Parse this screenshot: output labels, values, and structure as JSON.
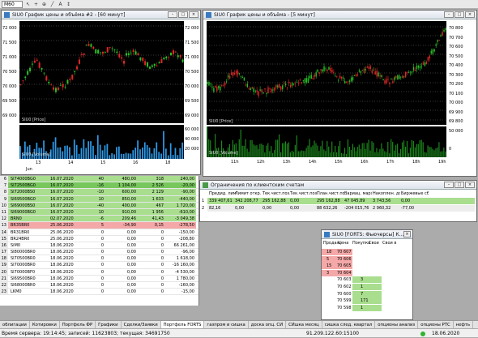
{
  "toolbar": {
    "combo": "M60",
    "icons": [
      "pointer-icon",
      "crosshair-icon",
      "zoom-icon",
      "line-icon",
      "text-icon",
      "arrows-icon"
    ]
  },
  "win1": {
    "title": "SIU0 График цены и объёма #2 - [60 минут]",
    "y_ticks": [
      "72 000",
      "71 500",
      "71 000",
      "70 500",
      "70 000",
      "69 500",
      "69 000"
    ],
    "price_label": "SIU0 [Price]",
    "volume_label": "SIU0 [Volume]",
    "vol_ticks": [
      "60 000",
      "40 000",
      "20 000"
    ],
    "x_ticks": [
      "13",
      "14",
      "15",
      "16",
      "18"
    ],
    "x_sub": "Jun"
  },
  "win2": {
    "title": "SIU0 График цены и объёма - [5 минут]",
    "y_ticks": [
      "70 800",
      "70 700",
      "70 600",
      "70 500",
      "70 400",
      "70 300",
      "70 200",
      "70 100",
      "70 000",
      "69 900",
      "69 800"
    ],
    "price_label": "SIU0 [Price]",
    "volume_label": "SIU0 [Volume]",
    "vol_ticks": [
      "50 000",
      "0"
    ],
    "x_ticks": [
      "11h",
      "12h",
      "13h",
      "14h",
      "15h",
      "16h",
      "17h",
      "18h",
      "19h"
    ]
  },
  "limits": {
    "title": "Ограничения по клиентским счетам",
    "headers": [
      "Предид. лимит",
      "Лимит откр. п",
      "Тек.чист.поз.",
      "Тек.чист.поз.",
      "План.чист.поз.",
      "Вариац. маржа",
      "Накоплен. доход",
      "Биржевые сборы"
    ],
    "rows": [
      [
        "339 407,61",
        "342 208,77",
        "295 162,88",
        "0,00",
        "295 162,88",
        "47 045,89",
        "3 743,56",
        "0,00"
      ],
      [
        "82,16",
        "0,00",
        "0,00",
        "0,00",
        "88 632,26",
        "-204 015,76",
        "2 960,32",
        "-77,00"
      ]
    ]
  },
  "orderbook": {
    "title": "SIU0 [FORTS: Фьючерсы] К...",
    "headers": [
      "Продаж",
      "Цена",
      "Покупка",
      "Свои",
      "Свои в"
    ],
    "rows": [
      [
        "18",
        "70 607",
        ""
      ],
      [
        "5",
        "70 606",
        ""
      ],
      [
        "15",
        "70 605",
        ""
      ],
      [
        "3",
        "70 604",
        ""
      ],
      [
        "",
        "70 603",
        "3"
      ],
      [
        "",
        "70 602",
        "1"
      ],
      [
        "",
        "70 600",
        "7"
      ],
      [
        "",
        "70 599",
        "171"
      ],
      [
        "",
        "70 598",
        "1"
      ]
    ]
  },
  "orders": [
    [
      "6",
      "SI74000BG0",
      "16.07.2020",
      "40",
      "480,00",
      "318",
      "240,00",
      "g"
    ],
    [
      "7",
      "SI72500BG0",
      "16.07.2020",
      "-16",
      "1 104,00",
      "2 526",
      "-20,00",
      "gs"
    ],
    [
      "8",
      "SI72000BS0",
      "16.07.2020",
      "-10",
      "600,00",
      "2 129",
      "-90,00",
      "g"
    ],
    [
      "9",
      "SI69500BG0",
      "16.07.2020",
      "10",
      "850,00",
      "1 633",
      "-440,00",
      "g"
    ],
    [
      "10",
      "SI69000BS0",
      "16.07.2020",
      "-40",
      "400,00",
      "467",
      "1 720,00",
      "g"
    ],
    [
      "11",
      "SI69000BG0",
      "16.07.2020",
      "10",
      "910,00",
      "1 956",
      "-610,00",
      "g"
    ],
    [
      "12",
      "BRN0",
      "02.07.2020",
      "-6",
      "209,46",
      "41,43",
      "-3 049,38",
      "g"
    ],
    [
      "13",
      "BR35BR0",
      "25.06.2020",
      "5",
      "-34,90",
      "0,15",
      "-278,50",
      "r"
    ],
    [
      "14",
      "BR31BR0",
      "25.06.2020",
      "0",
      "0,00",
      "0",
      "-150,00",
      ""
    ],
    [
      "15",
      "BR24BR0",
      "25.06.2020",
      "0",
      "0,00",
      "0",
      "-208,80",
      ""
    ],
    [
      "16",
      "SiM0",
      "18.06.2020",
      "0",
      "0,00",
      "0",
      "66 261,00",
      ""
    ],
    [
      "17",
      "SI80000BR0",
      "18.06.2020",
      "0",
      "0,00",
      "0",
      "-96,00",
      ""
    ],
    [
      "18",
      "SI70500BR0",
      "18.06.2020",
      "0",
      "0,00",
      "0",
      "1 618,00",
      ""
    ],
    [
      "19",
      "SI70000BR0",
      "18.06.2020",
      "0",
      "0,00",
      "0",
      "-16 160,00",
      ""
    ],
    [
      "20",
      "SI70000BF0",
      "18.06.2020",
      "0",
      "0,00",
      "0",
      "-4 530,00",
      ""
    ],
    [
      "21",
      "SI69500BR0",
      "18.06.2020",
      "0",
      "0,00",
      "0",
      "1 780,00",
      ""
    ],
    [
      "22",
      "SI68000BR0",
      "18.06.2020",
      "0",
      "0,00",
      "0",
      "-160,00",
      ""
    ],
    [
      "23",
      "LKM0",
      "18.06.2020",
      "0",
      "0,00",
      "0",
      "-15,00",
      ""
    ]
  ],
  "tabs": [
    "облигации",
    "Котировки",
    "Портфель ФР",
    "Графики",
    "Сделки/Заявки",
    "Портфель FORTS",
    "газпром и сишка",
    "доска опц. СИ",
    "СИшка месяц",
    "сишка след. квартал",
    "опционы анализ",
    "опционы РТС",
    "нефть"
  ],
  "active_tab": "Портфель FORTS",
  "status": {
    "left": "Время сервера: 19:14:45; записей: 11623803; текущая: 34691750",
    "conn": "91.209.122.60:15100",
    "date": "18.06.2020"
  }
}
